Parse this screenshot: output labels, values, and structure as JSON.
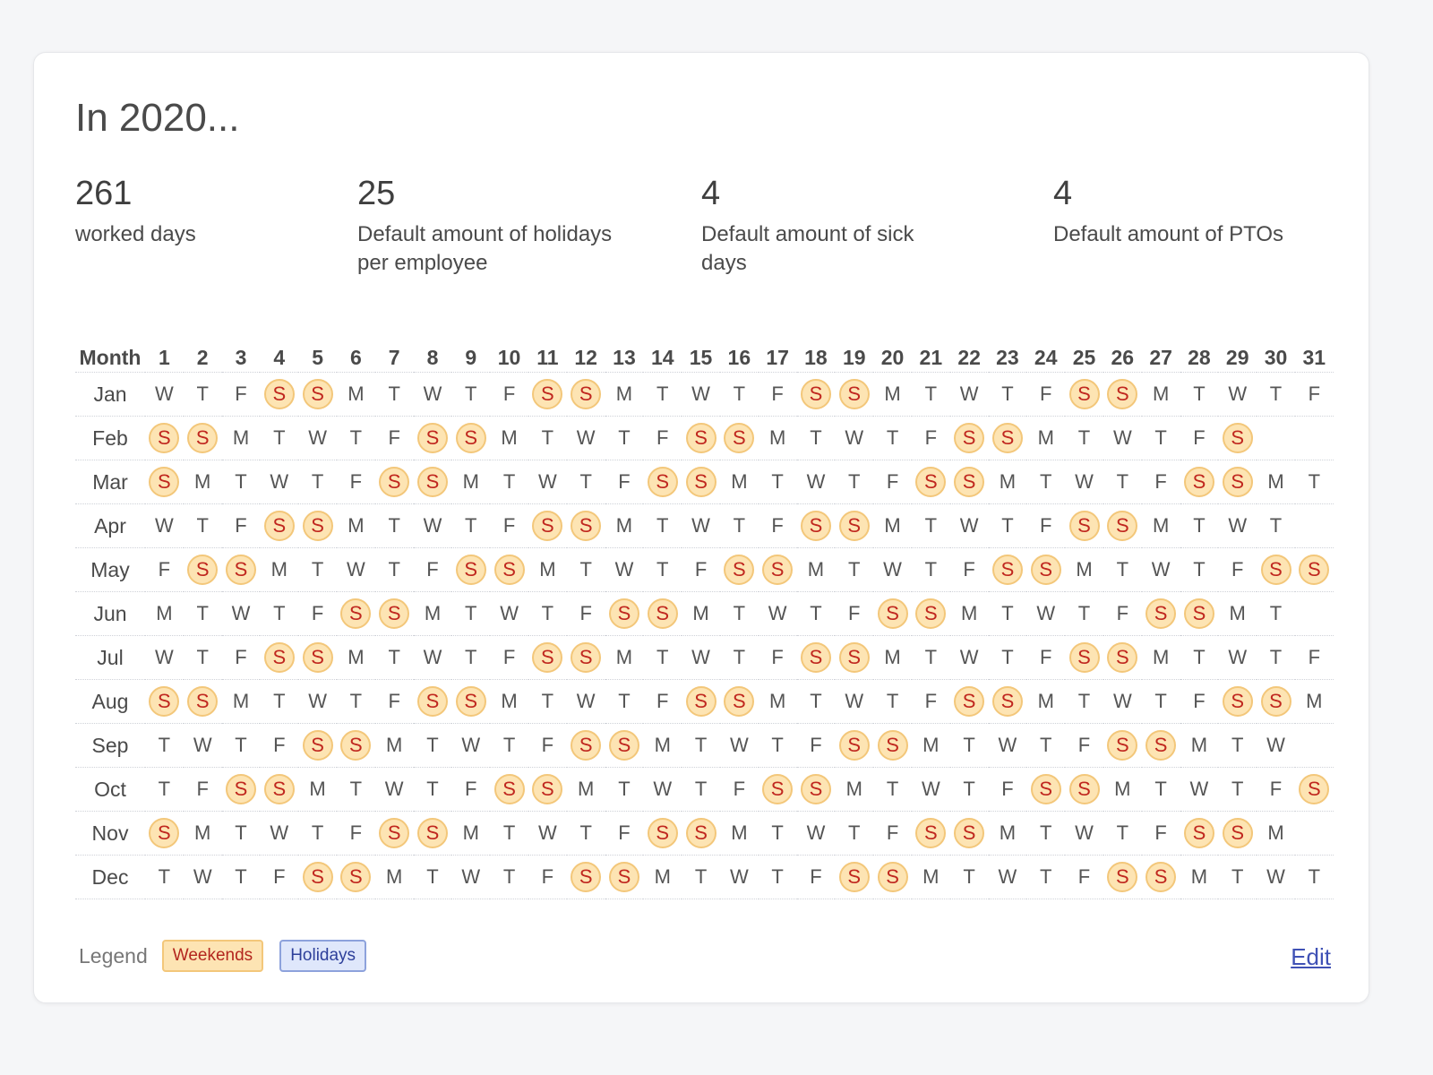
{
  "title": "In 2020...",
  "stats": [
    {
      "value": "261",
      "label": "worked days"
    },
    {
      "value": "25",
      "label": "Default amount of holidays per employee"
    },
    {
      "value": "4",
      "label": "Default amount of sick days"
    },
    {
      "value": "4",
      "label": "Default amount of PTOs"
    }
  ],
  "calendar": {
    "month_header": "Month",
    "weekend_marker": "S",
    "days": [
      "1",
      "2",
      "3",
      "4",
      "5",
      "6",
      "7",
      "8",
      "9",
      "10",
      "11",
      "12",
      "13",
      "14",
      "15",
      "16",
      "17",
      "18",
      "19",
      "20",
      "21",
      "22",
      "23",
      "24",
      "25",
      "26",
      "27",
      "28",
      "29",
      "30",
      "31"
    ],
    "months": [
      {
        "name": "Jan",
        "days": [
          "W",
          "T",
          "F",
          "S",
          "S",
          "M",
          "T",
          "W",
          "T",
          "F",
          "S",
          "S",
          "M",
          "T",
          "W",
          "T",
          "F",
          "S",
          "S",
          "M",
          "T",
          "W",
          "T",
          "F",
          "S",
          "S",
          "M",
          "T",
          "W",
          "T",
          "F"
        ]
      },
      {
        "name": "Feb",
        "days": [
          "S",
          "S",
          "M",
          "T",
          "W",
          "T",
          "F",
          "S",
          "S",
          "M",
          "T",
          "W",
          "T",
          "F",
          "S",
          "S",
          "M",
          "T",
          "W",
          "T",
          "F",
          "S",
          "S",
          "M",
          "T",
          "W",
          "T",
          "F",
          "S"
        ]
      },
      {
        "name": "Mar",
        "days": [
          "S",
          "M",
          "T",
          "W",
          "T",
          "F",
          "S",
          "S",
          "M",
          "T",
          "W",
          "T",
          "F",
          "S",
          "S",
          "M",
          "T",
          "W",
          "T",
          "F",
          "S",
          "S",
          "M",
          "T",
          "W",
          "T",
          "F",
          "S",
          "S",
          "M",
          "T"
        ]
      },
      {
        "name": "Apr",
        "days": [
          "W",
          "T",
          "F",
          "S",
          "S",
          "M",
          "T",
          "W",
          "T",
          "F",
          "S",
          "S",
          "M",
          "T",
          "W",
          "T",
          "F",
          "S",
          "S",
          "M",
          "T",
          "W",
          "T",
          "F",
          "S",
          "S",
          "M",
          "T",
          "W",
          "T"
        ]
      },
      {
        "name": "May",
        "days": [
          "F",
          "S",
          "S",
          "M",
          "T",
          "W",
          "T",
          "F",
          "S",
          "S",
          "M",
          "T",
          "W",
          "T",
          "F",
          "S",
          "S",
          "M",
          "T",
          "W",
          "T",
          "F",
          "S",
          "S",
          "M",
          "T",
          "W",
          "T",
          "F",
          "S",
          "S"
        ]
      },
      {
        "name": "Jun",
        "days": [
          "M",
          "T",
          "W",
          "T",
          "F",
          "S",
          "S",
          "M",
          "T",
          "W",
          "T",
          "F",
          "S",
          "S",
          "M",
          "T",
          "W",
          "T",
          "F",
          "S",
          "S",
          "M",
          "T",
          "W",
          "T",
          "F",
          "S",
          "S",
          "M",
          "T"
        ]
      },
      {
        "name": "Jul",
        "days": [
          "W",
          "T",
          "F",
          "S",
          "S",
          "M",
          "T",
          "W",
          "T",
          "F",
          "S",
          "S",
          "M",
          "T",
          "W",
          "T",
          "F",
          "S",
          "S",
          "M",
          "T",
          "W",
          "T",
          "F",
          "S",
          "S",
          "M",
          "T",
          "W",
          "T",
          "F"
        ]
      },
      {
        "name": "Aug",
        "days": [
          "S",
          "S",
          "M",
          "T",
          "W",
          "T",
          "F",
          "S",
          "S",
          "M",
          "T",
          "W",
          "T",
          "F",
          "S",
          "S",
          "M",
          "T",
          "W",
          "T",
          "F",
          "S",
          "S",
          "M",
          "T",
          "W",
          "T",
          "F",
          "S",
          "S",
          "M"
        ]
      },
      {
        "name": "Sep",
        "days": [
          "T",
          "W",
          "T",
          "F",
          "S",
          "S",
          "M",
          "T",
          "W",
          "T",
          "F",
          "S",
          "S",
          "M",
          "T",
          "W",
          "T",
          "F",
          "S",
          "S",
          "M",
          "T",
          "W",
          "T",
          "F",
          "S",
          "S",
          "M",
          "T",
          "W"
        ]
      },
      {
        "name": "Oct",
        "days": [
          "T",
          "F",
          "S",
          "S",
          "M",
          "T",
          "W",
          "T",
          "F",
          "S",
          "S",
          "M",
          "T",
          "W",
          "T",
          "F",
          "S",
          "S",
          "M",
          "T",
          "W",
          "T",
          "F",
          "S",
          "S",
          "M",
          "T",
          "W",
          "T",
          "F",
          "S"
        ]
      },
      {
        "name": "Nov",
        "days": [
          "S",
          "M",
          "T",
          "W",
          "T",
          "F",
          "S",
          "S",
          "M",
          "T",
          "W",
          "T",
          "F",
          "S",
          "S",
          "M",
          "T",
          "W",
          "T",
          "F",
          "S",
          "S",
          "M",
          "T",
          "W",
          "T",
          "F",
          "S",
          "S",
          "M"
        ]
      },
      {
        "name": "Dec",
        "days": [
          "T",
          "W",
          "T",
          "F",
          "S",
          "S",
          "M",
          "T",
          "W",
          "T",
          "F",
          "S",
          "S",
          "M",
          "T",
          "W",
          "T",
          "F",
          "S",
          "S",
          "M",
          "T",
          "W",
          "T",
          "F",
          "S",
          "S",
          "M",
          "T",
          "W",
          "T"
        ]
      }
    ]
  },
  "legend": {
    "label": "Legend",
    "weekends": "Weekends",
    "holidays": "Holidays"
  },
  "edit_label": "Edit",
  "colors": {
    "weekend_bg": "#fde4b3",
    "weekend_border": "#f3c77a",
    "weekend_text": "#c0271f",
    "holiday_bg": "#dfe7fb",
    "holiday_border": "#8da2dc",
    "link": "#3f51b5"
  }
}
